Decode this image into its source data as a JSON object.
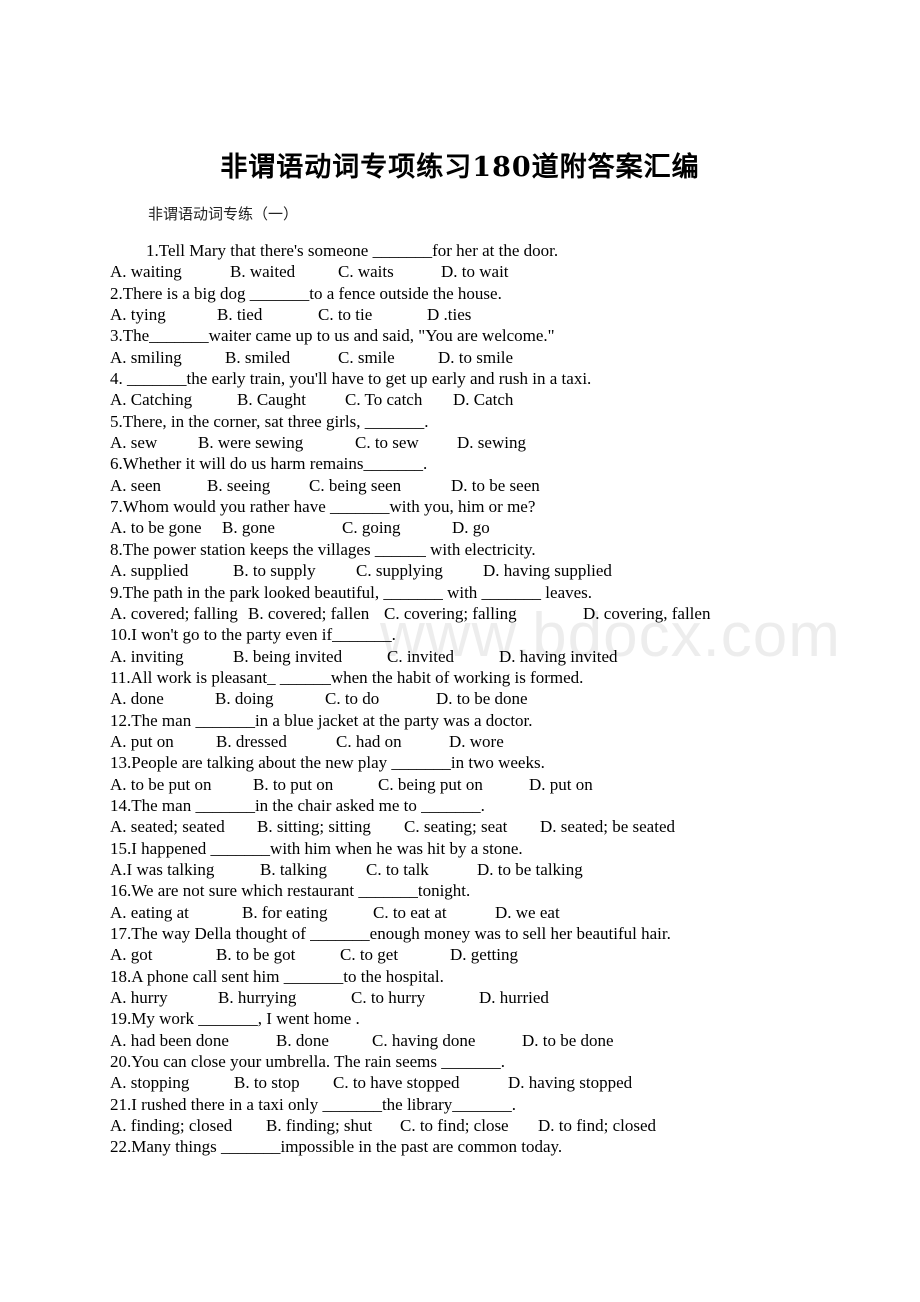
{
  "document": {
    "title": "非谓语动词专项练习180道附答案汇编",
    "section_heading": "非谓语动词专练（一）",
    "watermark": "www.bdocx.com",
    "questions": [
      {
        "stem": "1.Tell Mary that there's someone _______for her at the door.",
        "options": [
          "A. waiting",
          "B. waited",
          "C. waits",
          "D. to wait"
        ]
      },
      {
        "stem": "2.There is a big dog _______to a fence outside the house.",
        "options": [
          "A. tying",
          "B. tied",
          "C. to tie",
          "D .ties"
        ]
      },
      {
        "stem": "3.The_______waiter came up to us and said, \"You are welcome.\"",
        "options": [
          "A. smiling",
          "B. smiled",
          "C. smile",
          "D. to smile"
        ]
      },
      {
        "stem": "4. _______the early train, you'll have to get up early and rush in a taxi.",
        "options": [
          "A. Catching",
          "B. Caught",
          "C. To catch",
          "D. Catch"
        ]
      },
      {
        "stem": "5.There, in the corner, sat three girls, _______.",
        "options": [
          "A. sew",
          "B. were sewing",
          "C. to sew",
          "D. sewing"
        ]
      },
      {
        "stem": "6.Whether it will do us harm remains_______.",
        "options": [
          "A. seen",
          "B. seeing",
          "C. being seen",
          "D. to be seen"
        ]
      },
      {
        "stem": "7.Whom would you rather have _______with you, him or me?",
        "options": [
          "A. to be gone",
          "B. gone",
          "C. going",
          "D. go"
        ]
      },
      {
        "stem": "8.The power station keeps the villages ______ with electricity.",
        "options": [
          "A. supplied",
          "B. to supply",
          "C. supplying",
          "D. having supplied"
        ]
      },
      {
        "stem": "9.The path in the park looked beautiful, _______ with _______ leaves.",
        "options": [
          "A. covered; falling",
          "B. covered; fallen",
          "C. covering; falling",
          "D. covering, fallen"
        ]
      },
      {
        "stem": "10.I won't go to the party even if_______.",
        "options": [
          "A. inviting",
          "B. being invited",
          "C. invited",
          "D. having invited"
        ]
      },
      {
        "stem": "11.All work is pleasant_ ______when the habit of working is formed.",
        "options": [
          "A. done",
          "B. doing",
          "C. to do",
          "D. to be done"
        ]
      },
      {
        "stem": "12.The man _______in a blue jacket at the party was a doctor.",
        "options": [
          "A. put on",
          "B. dressed",
          "C. had on",
          "D. wore"
        ]
      },
      {
        "stem": "13.People are talking about the new play _______in two weeks.",
        "options": [
          "A. to be put on",
          "B. to put on",
          "C. being put on",
          "D. put on"
        ]
      },
      {
        "stem": "14.The man _______in the chair asked me to _______.",
        "options": [
          "A. seated; seated",
          "B. sitting; sitting",
          "C. seating; seat",
          "D. seated; be seated"
        ]
      },
      {
        "stem": "15.I happened _______with him when he was hit by a stone.",
        "options": [
          "A.I was talking",
          "B. talking",
          "C. to talk",
          "D. to be talking"
        ]
      },
      {
        "stem": "16.We are not sure which restaurant _______tonight.",
        "options": [
          "A. eating at",
          "B. for eating",
          "C. to eat at",
          "D. we eat"
        ]
      },
      {
        "stem": "17.The way Della thought of _______enough money was to sell her beautiful hair.",
        "options": [
          "A. got",
          "B. to be got",
          "C. to get",
          "D. getting"
        ]
      },
      {
        "stem": "18.A phone call sent him _______to the hospital.",
        "options": [
          "A. hurry",
          "B. hurrying",
          "C. to hurry",
          "D. hurried"
        ]
      },
      {
        "stem": "19.My work _______, I went home .",
        "options": [
          "A. had been done",
          "B. done",
          "C. having done",
          "D. to be done"
        ]
      },
      {
        "stem": "20.You can close your umbrella. The rain seems _______.",
        "options": [
          "A. stopping",
          "B. to stop",
          "C. to have stopped",
          "D. having stopped"
        ]
      },
      {
        "stem": "21.I rushed there in a taxi only _______the library_______.",
        "options": [
          "A. finding; closed",
          "B. finding; shut",
          "C. to find; close",
          "D. to find; closed"
        ]
      },
      {
        "stem": "22.Many things _______impossible in the past are common today.",
        "options": []
      }
    ]
  }
}
